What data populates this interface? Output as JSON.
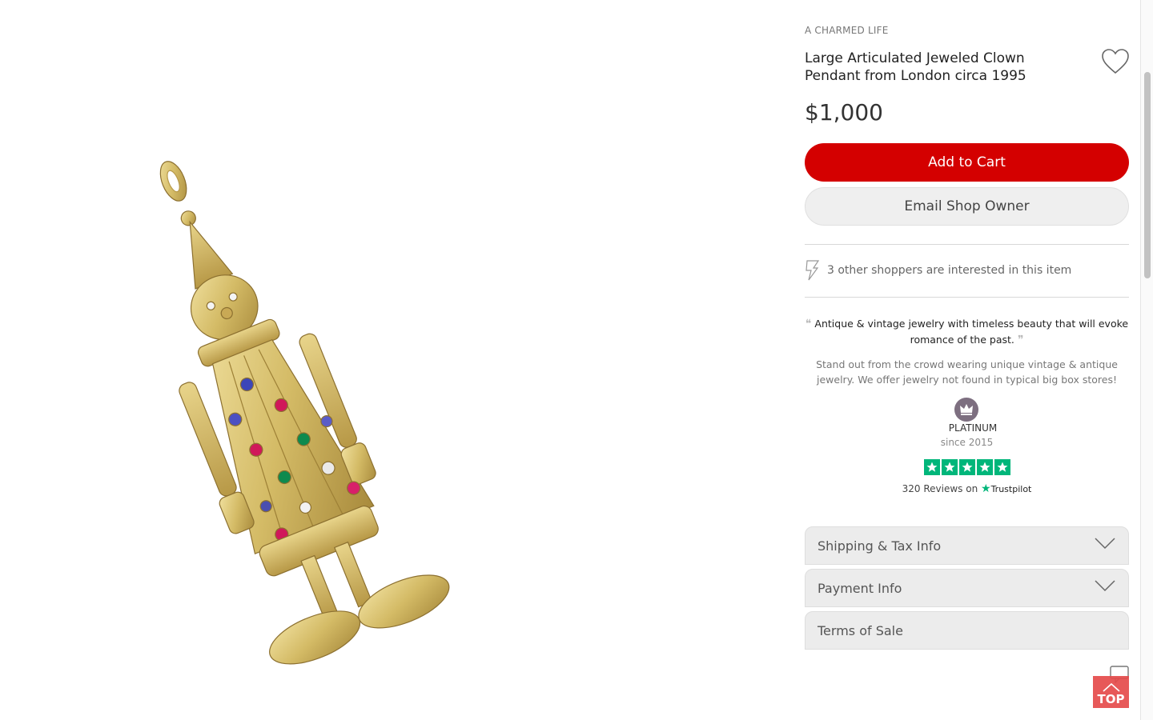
{
  "product": {
    "shop_name": "A CHARMED LIFE",
    "title": "Large Articulated Jeweled Clown Pendant from London circa 1995",
    "price": "$1,000"
  },
  "actions": {
    "add_to_cart": "Add to Cart",
    "email_owner": "Email Shop Owner"
  },
  "interest": {
    "text": "3 other shoppers are interested in this item"
  },
  "shop": {
    "tagline": "Antique & vintage jewelry with timeless beauty that will evoke romance of the past.",
    "description": "Stand out from the crowd wearing unique vintage & antique jewelry. We offer jewelry not found in typical big box stores!",
    "tier": "PLATINUM",
    "since": "since 2015",
    "reviews_text": "320 Reviews on",
    "reviews_brand": "Trustpilot",
    "rating_stars": 5
  },
  "accordion": [
    {
      "label": "Shipping & Tax Info"
    },
    {
      "label": "Payment Info"
    },
    {
      "label": "Terms of Sale"
    }
  ],
  "widgets": {
    "top_label": "TOP"
  },
  "colors": {
    "cart_button": "#d40000",
    "trustpilot_green": "#00b67a",
    "gold": "#d6be6a",
    "top_button": "#e54c4c"
  }
}
